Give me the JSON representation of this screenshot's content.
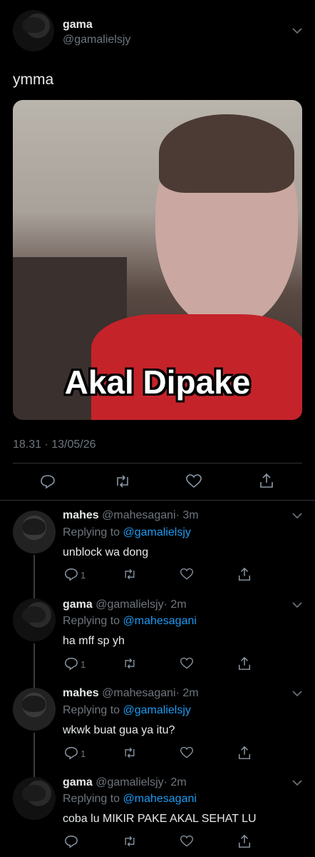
{
  "tweet": {
    "name": "gama",
    "handle": "@gamalielsjy",
    "text": "ymma",
    "image_caption": "Akal Dipake",
    "timestamp": "18.31 · 13/05/26"
  },
  "replies": [
    {
      "name": "mahes",
      "handle": "@mahesagani",
      "time": "· 3m",
      "replying_label": "Replying to",
      "replying_to": "@gamalielsjy",
      "text": "unblock wa dong",
      "reply_count": "1"
    },
    {
      "name": "gama",
      "handle": "@gamalielsjy",
      "time": "· 2m",
      "replying_label": "Replying to",
      "replying_to": "@mahesagani",
      "text": "ha mff sp yh",
      "reply_count": "1"
    },
    {
      "name": "mahes",
      "handle": "@mahesagani",
      "time": "· 2m",
      "replying_label": "Replying to",
      "replying_to": "@gamalielsjy",
      "text": "wkwk buat gua ya itu?",
      "reply_count": "1"
    },
    {
      "name": "gama",
      "handle": "@gamalielsjy",
      "time": "· 2m",
      "replying_label": "Replying to",
      "replying_to": "@mahesagani",
      "text": "coba lu MIKIR PAKE AKAL SEHAT LU",
      "reply_count": ""
    }
  ],
  "colors": {
    "background": "#000000",
    "link": "#1d9bf0",
    "muted": "#6e767d"
  }
}
